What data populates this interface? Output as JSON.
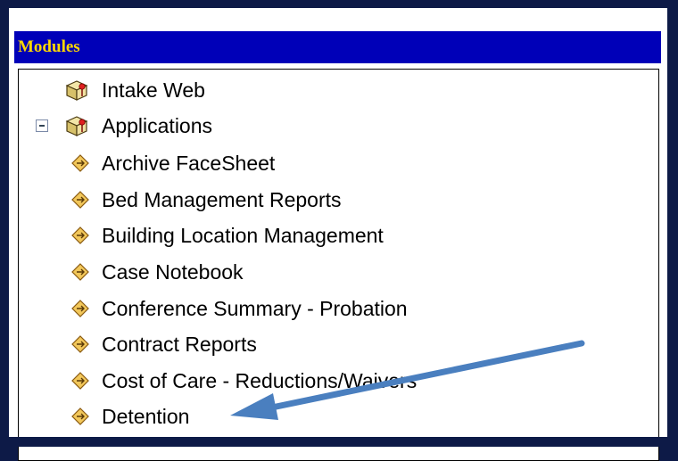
{
  "header": {
    "title": "Modules"
  },
  "tree": {
    "intake": "Intake Web",
    "applications": "Applications",
    "items": [
      "Archive FaceSheet",
      "Bed Management Reports",
      "Building Location Management",
      "Case Notebook",
      "Conference Summary - Probation",
      "Contract Reports",
      "Cost of Care - Reductions/Waivers",
      "Detention"
    ]
  },
  "colors": {
    "header_bg": "#0000b8",
    "header_text": "#ffd800",
    "frame": "#0d1a47",
    "annotation_arrow": "#4a7fbf"
  }
}
